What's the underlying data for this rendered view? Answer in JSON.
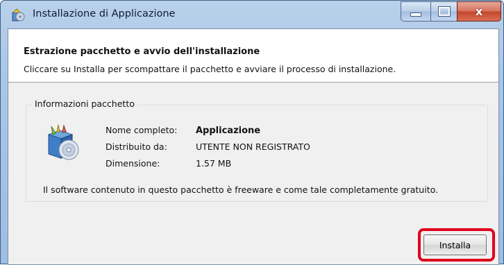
{
  "window": {
    "title": "Installazione di Applicazione",
    "controls": {
      "minimize": "minimize",
      "maximize": "maximize",
      "close": "x"
    }
  },
  "header": {
    "title": "Estrazione pacchetto e avvio dell'installazione",
    "description": "Cliccare su Installa per scompattare il pacchetto e avviare il processo di installazione."
  },
  "package_info": {
    "group_label": "Informazioni pacchetto",
    "rows": [
      {
        "label": "Nome completo:",
        "value": "Applicazione"
      },
      {
        "label": "Distribuito da:",
        "value": "UTENTE NON REGISTRATO"
      },
      {
        "label": "Dimensione:",
        "value": "1.57 MB"
      }
    ],
    "note": "Il software contenuto in questo pacchetto è freeware e come tale completamente gratuito."
  },
  "footer": {
    "install_label": "Installa"
  },
  "colors": {
    "highlight": "#e0001b",
    "titlebar": "#a9c6e6",
    "close": "#c4462a"
  },
  "icons": {
    "app": "installer-app-icon",
    "package": "software-package-icon"
  }
}
